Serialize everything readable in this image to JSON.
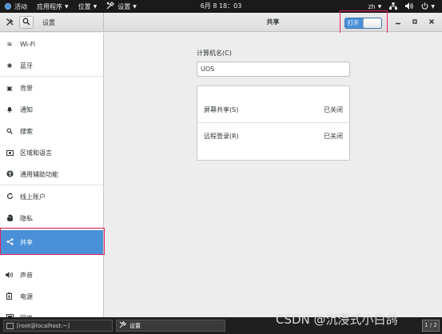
{
  "topbar": {
    "activities": "活动",
    "applications": "应用程序",
    "places": "位置",
    "settings_menu": "设置",
    "clock": "6月 8 18：03",
    "input_method": "zh"
  },
  "headerbar": {
    "sidebar_title": "设置",
    "panel_title": "共享",
    "toggle_label": "打开"
  },
  "sidebar": {
    "items": [
      {
        "label": "Wi-Fi",
        "icon": "wifi-icon",
        "glyph": "≋"
      },
      {
        "label": "蓝牙",
        "icon": "bluetooth-icon",
        "glyph": "✱"
      },
      {
        "label": "背景",
        "icon": "background-icon",
        "glyph": "▣"
      },
      {
        "label": "通知",
        "icon": "bell-icon",
        "glyph": "🔔"
      },
      {
        "label": "搜索",
        "icon": "search-icon",
        "glyph": "⌕"
      },
      {
        "label": "区域和语言",
        "icon": "camera-icon",
        "glyph": "▭"
      },
      {
        "label": "通用辅助功能",
        "icon": "accessibility-icon",
        "glyph": "◉"
      },
      {
        "label": "线上账户",
        "icon": "online-accounts-icon",
        "glyph": "↻"
      },
      {
        "label": "隐私",
        "icon": "privacy-icon",
        "glyph": "✋"
      },
      {
        "label": "共享",
        "icon": "share-icon",
        "glyph": "⋖"
      },
      {
        "label": "声音",
        "icon": "sound-icon",
        "glyph": "◀)"
      },
      {
        "label": "电源",
        "icon": "power-icon",
        "glyph": "⚡"
      },
      {
        "label": "网络",
        "icon": "network-icon",
        "glyph": "▤"
      }
    ]
  },
  "content": {
    "computer_name_label": "计算机名(C)",
    "computer_name_value": "UOS",
    "rows": [
      {
        "label": "屏幕共享(S)",
        "status": "已关闭"
      },
      {
        "label": "远程登录(R)",
        "status": "已关闭"
      }
    ]
  },
  "taskbar": {
    "terminal_task": "[root@localhost:~]",
    "settings_task": "设置",
    "workspace": "1 / 2"
  },
  "watermark": "CSDN @沉浸式小白鸽"
}
